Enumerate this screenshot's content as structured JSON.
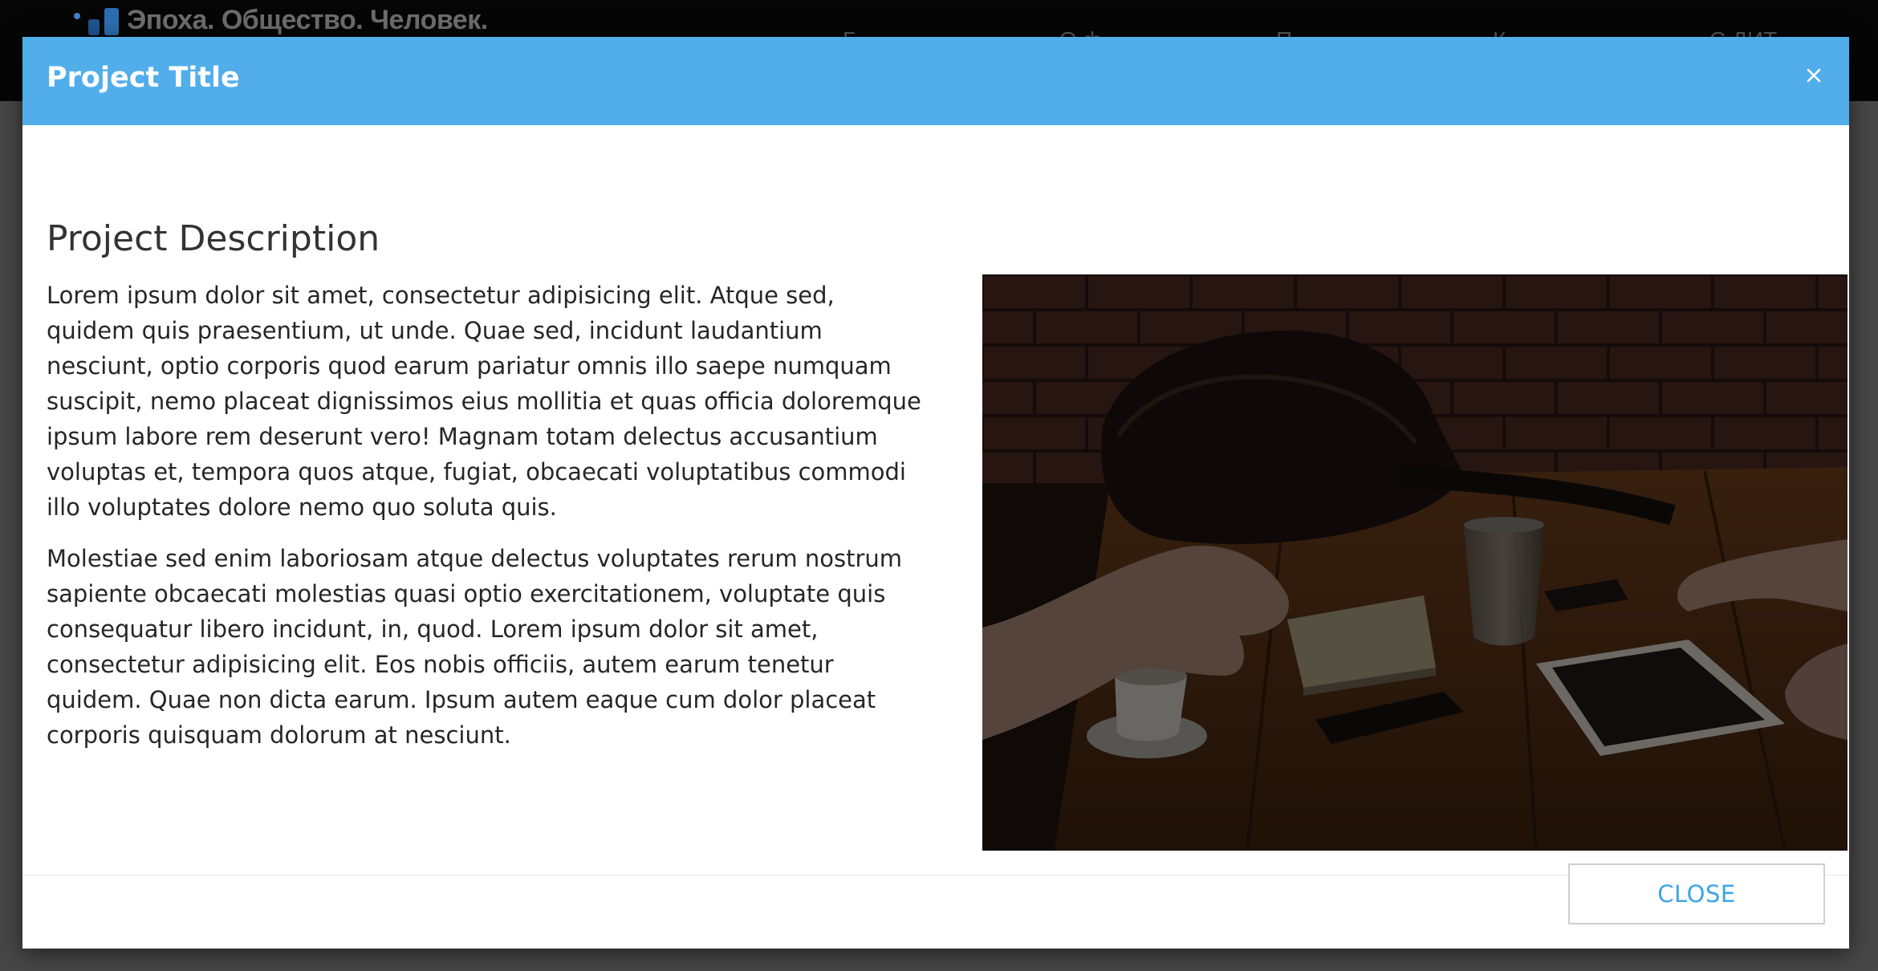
{
  "background": {
    "logo_text": "Эпоха. Общество. Человек.",
    "nav_items": [
      "Г",
      "О ф",
      "П",
      "К",
      "С ДИТ"
    ]
  },
  "modal": {
    "title": "Project Title",
    "heading": "Project Description",
    "paragraphs": [
      "Lorem ipsum dolor sit amet, consectetur adipisicing elit. Atque sed, quidem quis praesentium, ut unde. Quae sed, incidunt laudantium nesciunt, optio corporis quod earum pariatur omnis illo saepe numquam suscipit, nemo placeat dignissimos eius mollitia et quas officia doloremque ipsum labore rem deserunt vero! Magnam totam delectus accusantium voluptas et, tempora quos atque, fugiat, obcaecati voluptatibus commodi illo voluptates dolore nemo quo soluta quis.",
      "Molestiae sed enim laboriosam atque delectus voluptates rerum nostrum sapiente obcaecati molestias quasi optio exercitationem, voluptate quis consequatur libero incidunt, in, quod. Lorem ipsum dolor sit amet, consectetur adipisicing elit. Eos nobis officiis, autem earum tenetur quidem. Quae non dicta earum. Ipsum autem eaque cum dolor placeat corporis quisquam dolorum at nesciunt."
    ],
    "close_label": "CLOSE",
    "colors": {
      "header": "#52aeeb",
      "close_text": "#3ea4e8"
    }
  }
}
